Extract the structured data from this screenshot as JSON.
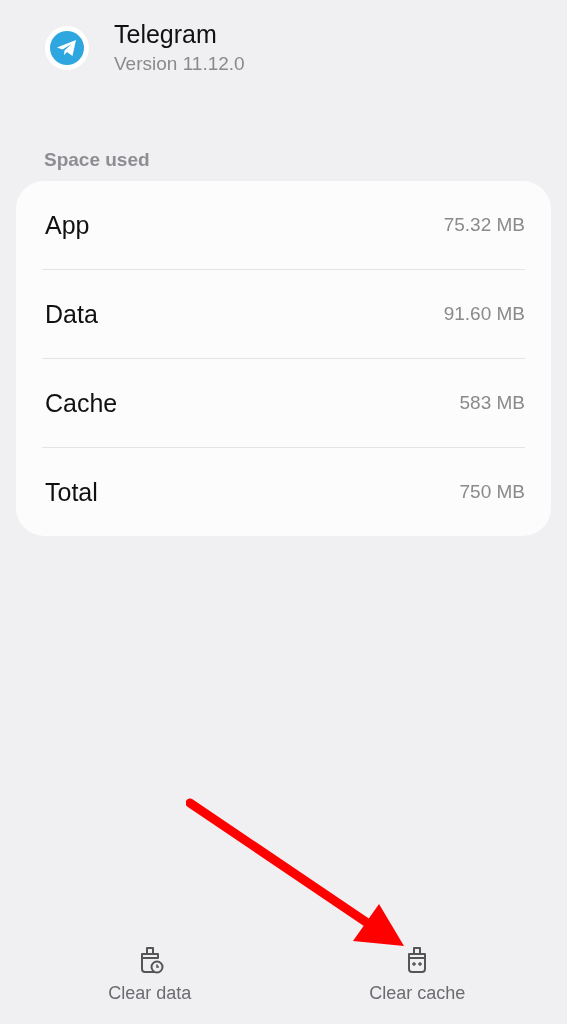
{
  "app": {
    "name": "Telegram",
    "version": "Version 11.12.0"
  },
  "section_title": "Space used",
  "storage": [
    {
      "label": "App",
      "value": "75.32 MB"
    },
    {
      "label": "Data",
      "value": "91.60 MB"
    },
    {
      "label": "Cache",
      "value": "583 MB"
    },
    {
      "label": "Total",
      "value": "750 MB"
    }
  ],
  "actions": [
    {
      "kind": "data",
      "label": "Clear data"
    },
    {
      "kind": "cache",
      "label": "Clear cache"
    }
  ],
  "annotation": {
    "kind": "arrow"
  }
}
